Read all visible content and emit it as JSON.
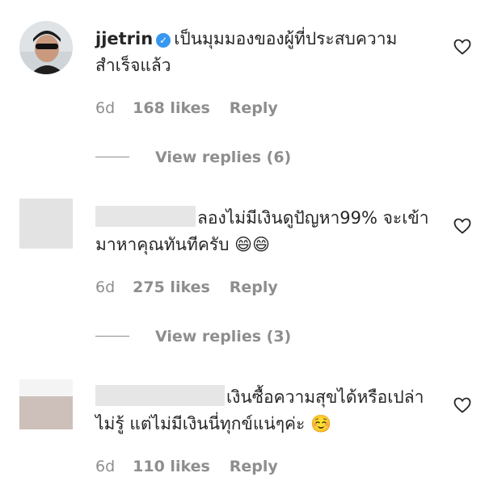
{
  "comments": [
    {
      "username": "jjetrin",
      "verified": true,
      "text": "เป็นมุมมองของผู้ที่ประสบความสำเร็จแล้ว",
      "time": "6d",
      "likes": "168 likes",
      "reply": "Reply",
      "view_replies": "View replies (6)"
    },
    {
      "username": "",
      "text": "ลองไม่มีเงินดูปัญหา99% จะเข้ามาหาคุณทันทีครับ 😄😄",
      "time": "6d",
      "likes": "275 likes",
      "reply": "Reply",
      "view_replies": "View replies (3)"
    },
    {
      "username": "",
      "text": "เงินซื้อความสุขได้หรือเปล่าไม่รู้ แต่ไม่มีเงินนี่ทุกข์แน่ๆค่ะ ☺️",
      "time": "6d",
      "likes": "110 likes",
      "reply": "Reply"
    }
  ]
}
